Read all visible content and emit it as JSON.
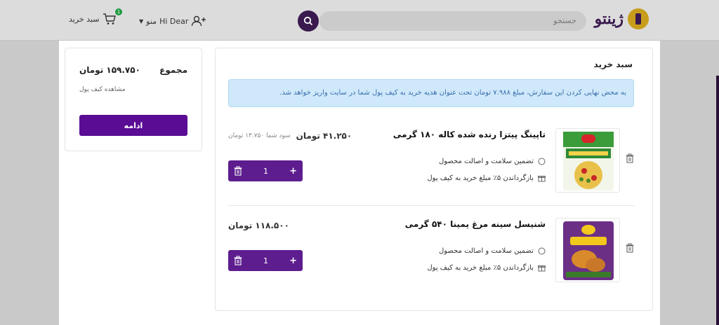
{
  "header": {
    "logo_text": "ژینتو",
    "search_placeholder": "جستجو",
    "user_label": "Hi Dear",
    "menu_label": "منو",
    "cart_label": "سبد خرید",
    "cart_count": "1"
  },
  "cart": {
    "title": "سبد خرید",
    "notice": "به محض نهایی کردن این سفارش، مبلغ ۷.۹۸۸ تومان تحت عنوان هدیه خرید به کیف پول شما در سایت واریز خواهد شد.",
    "items": [
      {
        "name": "تاپینگ پیتزا رنده شده کاله ۱۸۰ گرمی",
        "feature_guarantee": "تضمین سلامت و اصالت محصول",
        "feature_cashback": "بازگرداندن ۵٪ مبلغ خرید به کیف پول",
        "price": "۴۱.۲۵۰ تومان",
        "savings": "سود شما ۱۳.۷۵۰ تومان",
        "quantity": "1"
      },
      {
        "name": "شنیسل سینه مرغ یمینا ۵۴۰ گرمی",
        "feature_guarantee": "تضمین سلامت و اصالت محصول",
        "feature_cashback": "بازگرداندن ۵٪ مبلغ خرید به کیف پول",
        "price": "۱۱۸.۵۰۰ تومان",
        "quantity": "1"
      }
    ]
  },
  "summary": {
    "total_label": "مجموع",
    "total_value": "۱۵۹.۷۵۰ تومان",
    "wallet_link": "مشاهده کیف پول",
    "continue_label": "ادامه"
  },
  "colors": {
    "accent": "#5a0c95",
    "notice_bg": "#cfe8fa",
    "notice_text": "#3a6fae"
  }
}
